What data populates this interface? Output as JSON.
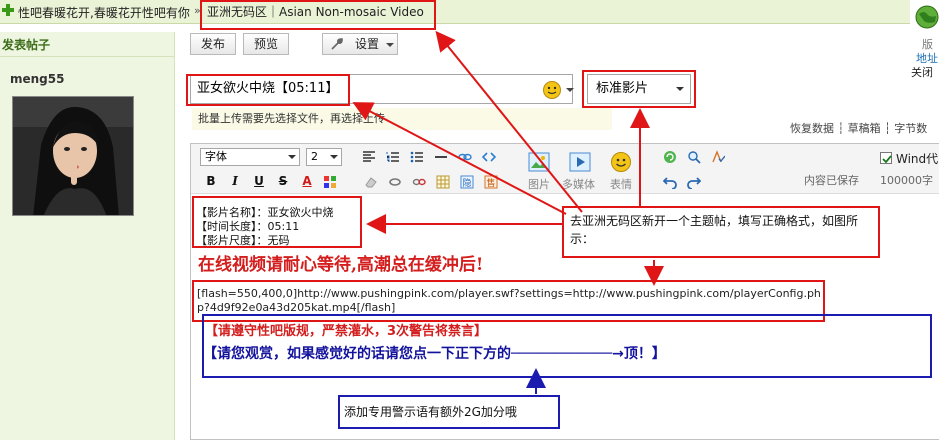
{
  "breadcrumb": {
    "text": "性吧春暖花开,春暖花开性吧有你",
    "separator": "»",
    "current": "亚洲无码区｜Asian Non-mosaic Video"
  },
  "float_widget": {
    "address": "地址",
    "close": "关闭"
  },
  "left": {
    "post_title_label": "发表帖子",
    "username": "meng55"
  },
  "toolbar": {
    "publish": "发布",
    "preview": "预览",
    "settings": "设置",
    "right_peek": "版"
  },
  "title_input": {
    "value": "亚女欲火中烧【05:11】"
  },
  "category": {
    "selected": "标准影片"
  },
  "upload_hint": "批量上传需要先选择文件，再选择上传",
  "draft_links": "恢复数据 ┆ 草稿箱 ┆ 字节数",
  "editor": {
    "font": "字体",
    "size": "2",
    "image": "图片",
    "media": "多媒体",
    "emoji": "表情",
    "autosave": "内容已保存",
    "word_count": "100000字",
    "wind_label": "Wind代"
  },
  "content": {
    "movie_name": "【影片名称】：亚女欲火中烧",
    "duration": "【时间长度】：05:11",
    "size": "【影片尺度】：无码",
    "waiting": "在线视频请耐心等待,高潮总在缓冲后!",
    "flash": "[flash=550,400,0]http://www.pushingpink.com/player.swf?settings=http://www.pushingpink.com/playerConfig.php?4d9f92e0a43d205kat.mp4[/flash]",
    "rules": "【请遵守性吧版规，严禁灌水，3次警告将禁言】",
    "enjoy": "【请您观赏，如果感觉好的话请您点一下正下方的────────────→顶！】"
  },
  "annotations": {
    "red": "去亚洲无码区新开一个主题帖，填写正确格式，如图所示：",
    "blue": "添加专用警示语有额外2G加分哦"
  },
  "colors": {
    "annotation_red": "#e01616",
    "annotation_blue": "#1b1bb0",
    "content_red": "#d41e1e",
    "content_blue": "#13139e",
    "forum_green": "#3c6e1a"
  }
}
